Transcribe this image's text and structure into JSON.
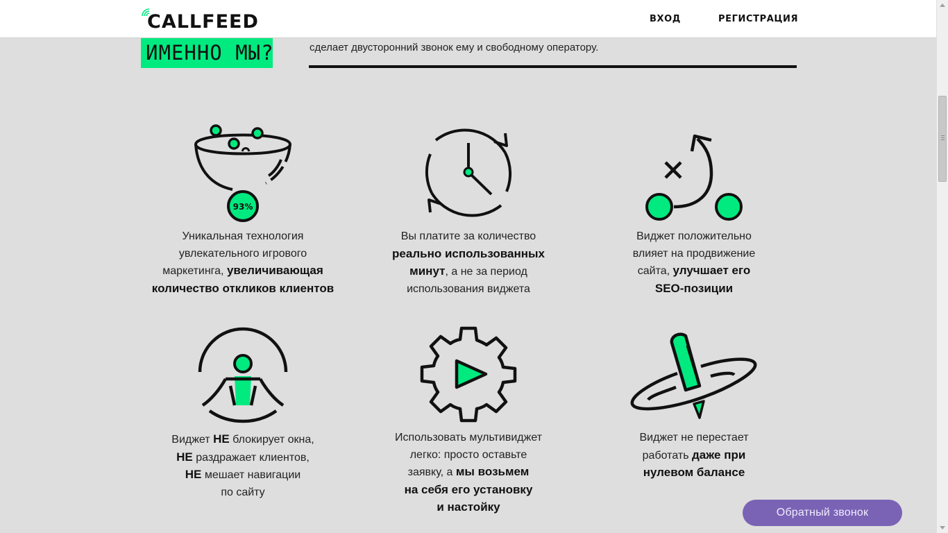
{
  "header": {
    "logo_text": "CALLFEED",
    "nav": {
      "login": "ВХОД",
      "register": "РЕГИСТРАЦИЯ"
    }
  },
  "section": {
    "heading": "ИМЕННО МЫ?",
    "intro": "сделает двусторонний звонок ему и свободному оператору."
  },
  "features": [
    {
      "icon": "funnel-icon",
      "badge": "93%",
      "lines": [
        [
          {
            "t": "Уникальная технология",
            "b": false
          }
        ],
        [
          {
            "t": "увлекательного игрового",
            "b": false
          }
        ],
        [
          {
            "t": "маркетинга, ",
            "b": false
          },
          {
            "t": "увеличивающая",
            "b": true
          }
        ],
        [
          {
            "t": "количество откликов клиентов",
            "b": true
          }
        ]
      ]
    },
    {
      "icon": "clock-icon",
      "lines": [
        [
          {
            "t": "Вы платите за количество",
            "b": false
          }
        ],
        [
          {
            "t": "реально использованных",
            "b": true
          }
        ],
        [
          {
            "t": "минут",
            "b": true
          },
          {
            "t": ", а не за период",
            "b": false
          }
        ],
        [
          {
            "t": "использования виджета",
            "b": false
          }
        ]
      ]
    },
    {
      "icon": "strategy-icon",
      "lines": [
        [
          {
            "t": "Виджет положительно",
            "b": false
          }
        ],
        [
          {
            "t": "влияет на продвижение",
            "b": false
          }
        ],
        [
          {
            "t": "сайта, ",
            "b": false
          },
          {
            "t": "улучшает его",
            "b": true
          }
        ],
        [
          {
            "t": "SEO-позиции",
            "b": true
          }
        ]
      ]
    },
    {
      "icon": "meditation-icon",
      "lines": [
        [
          {
            "t": "Виджет ",
            "b": false
          },
          {
            "t": "НЕ",
            "b": true
          },
          {
            "t": " блокирует окна,",
            "b": false
          }
        ],
        [
          {
            "t": "НЕ",
            "b": true
          },
          {
            "t": " раздражает клиентов,",
            "b": false
          }
        ],
        [
          {
            "t": "НЕ",
            "b": true
          },
          {
            "t": " мешает навигации",
            "b": false
          }
        ],
        [
          {
            "t": "по сайту",
            "b": false
          }
        ]
      ]
    },
    {
      "icon": "gear-play-icon",
      "lines": [
        [
          {
            "t": "Использовать мультивиджет",
            "b": false
          }
        ],
        [
          {
            "t": "легко: просто оставьте",
            "b": false
          }
        ],
        [
          {
            "t": "заявку, а ",
            "b": false
          },
          {
            "t": "мы возьмем",
            "b": true
          }
        ],
        [
          {
            "t": "на себя его установку",
            "b": true
          }
        ],
        [
          {
            "t": "и настойку",
            "b": true
          }
        ]
      ]
    },
    {
      "icon": "spinning-top-icon",
      "lines": [
        [
          {
            "t": "Виджет не перестает",
            "b": false
          }
        ],
        [
          {
            "t": "работать ",
            "b": false
          },
          {
            "t": "даже при",
            "b": true
          }
        ],
        [
          {
            "t": "нулевом балансе",
            "b": true
          }
        ]
      ]
    }
  ],
  "callback": {
    "label": "Обратный звонок"
  },
  "colors": {
    "accent": "#00ea7f",
    "background": "#dedede",
    "callback": "#7a63b5"
  }
}
